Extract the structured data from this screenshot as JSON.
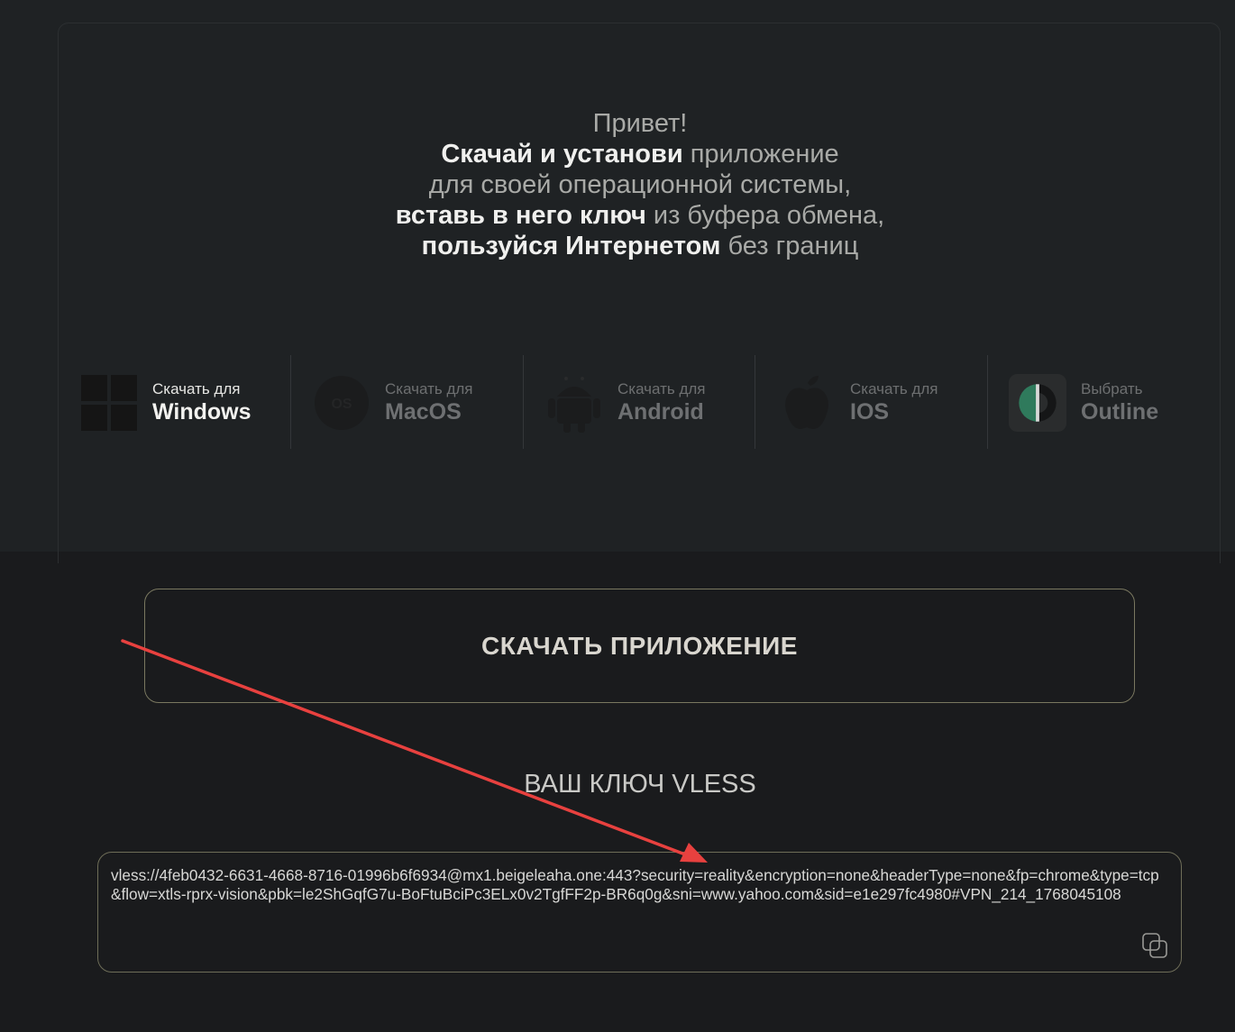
{
  "greeting": {
    "line1": "Привет!",
    "line2_bold": "Скачай и установи",
    "line2_rest": " приложение",
    "line3": "для своей операционной системы,",
    "line4_bold": "вставь в него ключ",
    "line4_rest": " из буфера обмена,",
    "line5_bold": "пользуйся Интернетом",
    "line5_rest": " без границ"
  },
  "platforms": [
    {
      "small": "Скачать для",
      "big": "Windows",
      "icon": "windows-icon",
      "active": true
    },
    {
      "small": "Скачать для",
      "big": "MacOS",
      "icon": "macos-icon",
      "active": false
    },
    {
      "small": "Скачать для",
      "big": "Android",
      "icon": "android-icon",
      "active": false
    },
    {
      "small": "Скачать для",
      "big": "IOS",
      "icon": "apple-icon",
      "active": false
    },
    {
      "small": "Выбрать",
      "big": "Outline",
      "icon": "outline-icon",
      "active": false
    }
  ],
  "download_button": "СКАЧАТЬ ПРИЛОЖЕНИЕ",
  "key_title": "ВАШ КЛЮЧ VLESS",
  "key_value": "vless://4feb0432-6631-4668-8716-01996b6f6934@mx1.beigeleaha.one:443?security=reality&encryption=none&headerType=none&fp=chrome&type=tcp&flow=xtls-rprx-vision&pbk=le2ShGqfG7u-BoFtuBciPc3ELx0v2TgfFF2p-BR6q0g&sni=www.yahoo.com&sid=e1e297fc4980#VPN_214_1768045108",
  "colors": {
    "accent_border": "#7a7860",
    "annotation_arrow": "#e8413f",
    "outline_green": "#2f7a5c"
  }
}
